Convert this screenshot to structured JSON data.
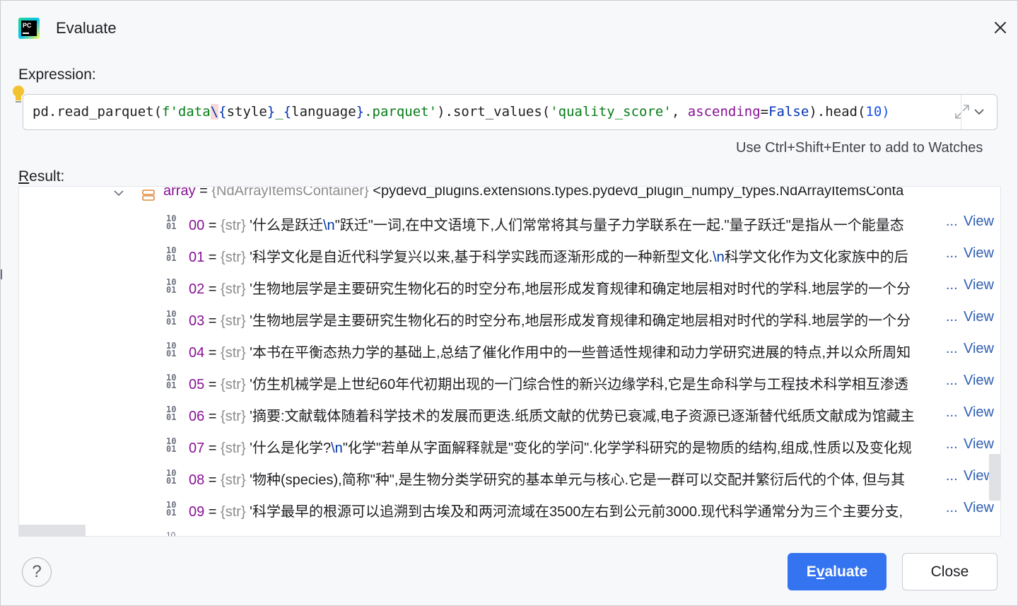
{
  "window": {
    "title": "Evaluate",
    "app_icon": "pycharm-logo-icon",
    "close_icon": "close-icon"
  },
  "expression": {
    "label": "Expression:",
    "code": {
      "p1": "pd.read_parquet(",
      "p2": "f'data",
      "p3": "\\",
      "p4": "{",
      "p5": "style",
      "p6": "}",
      "p7": "_",
      "p8": "{",
      "p9": "language",
      "p10": "}",
      "p11": ".parquet'",
      "p12": ").sort_values(",
      "p13": "'quality_score'",
      "p14": ", ",
      "p15": "ascending",
      "p16": "=",
      "p17": "False",
      "p18": ").head(",
      "p19": "10)"
    },
    "expand_icon": "expand-icon",
    "history_icon": "chevron-down-icon",
    "lightbulb_icon": "lightbulb-icon"
  },
  "hint": "Use Ctrl+Shift+Enter to add to Watches",
  "result": {
    "label_mnemonic": "R",
    "label_rest": "esult:",
    "root": {
      "name": "array",
      "eq": " = ",
      "type": "{NdArrayItemsContainer}",
      "value": " <pydevd_plugins.extensions.types.pydevd_plugin_numpy_types.NdArrayItemsConta"
    },
    "items": [
      {
        "index": "00",
        "type": "{str}",
        "pre": " '什么是跃迁",
        "esc": "\\n",
        "post": "\"跃迁\"一词,在中文语境下,人们常常将其与量子力学联系在一起.\"量子跃迁\"是指从一个能量态"
      },
      {
        "index": "01",
        "type": "{str}",
        "pre": " '科学文化是自近代科学复兴以来,基于科学实践而逐渐形成的一种新型文化.",
        "esc": "\\n",
        "post": "科学文化作为文化家族中的后"
      },
      {
        "index": "02",
        "type": "{str}",
        "pre": " '生物地层学是主要研究生物化石的时空分布,地层形成发育规律和确定地层相对时代的学科.地层学的一个分",
        "esc": "",
        "post": ""
      },
      {
        "index": "03",
        "type": "{str}",
        "pre": " '生物地层学是主要研究生物化石的时空分布,地层形成发育规律和确定地层相对时代的学科.地层学的一个分",
        "esc": "",
        "post": ""
      },
      {
        "index": "04",
        "type": "{str}",
        "pre": " '本书在平衡态热力学的基础上,总结了催化作用中的一些普适性规律和动力学研究进展的特点,并以众所周知",
        "esc": "",
        "post": ""
      },
      {
        "index": "05",
        "type": "{str}",
        "pre": " '仿生机械学是上世纪60年代初期出现的一门综合性的新兴边缘学科,它是生命科学与工程技术科学相互渗透",
        "esc": "",
        "post": ""
      },
      {
        "index": "06",
        "type": "{str}",
        "pre": " '摘要:文献载体随着科学技术的发展而更迭.纸质文献的优势已衰减,电子资源已逐渐替代纸质文献成为馆藏主",
        "esc": "",
        "post": ""
      },
      {
        "index": "07",
        "type": "{str}",
        "pre": " '什么是化学?",
        "esc": "\\n",
        "post": "\"化学\"若单从字面解释就是\"变化的学问\".化学学科研究的是物质的结构,组成,性质以及变化规"
      },
      {
        "index": "08",
        "type": "{str}",
        "pre": " '物种(species),简称\"种\",是生物分类学研究的基本单元与核心.它是一群可以交配并繁衍后代的个体, 但与其",
        "esc": "",
        "post": ""
      },
      {
        "index": "09",
        "type": "{str}",
        "pre": " '科学最早的根源可以追溯到古埃及和两河流域在3500左右到公元前3000.现代科学通常分为三个主要分支,",
        "esc": "",
        "post": ""
      }
    ],
    "ellipsis": "...",
    "view_label": "View",
    "item_icon": "binary-icon",
    "root_icon": "stack-icon"
  },
  "buttons": {
    "help_label": "?",
    "evaluate_pre": "E",
    "evaluate_mn": "v",
    "evaluate_post": "aluate",
    "close_label": "Close"
  },
  "colors": {
    "accent": "#3574f0",
    "link": "#2f5fb3",
    "name": "#871094",
    "string": "#067d17",
    "type": "#8c8c8c"
  }
}
